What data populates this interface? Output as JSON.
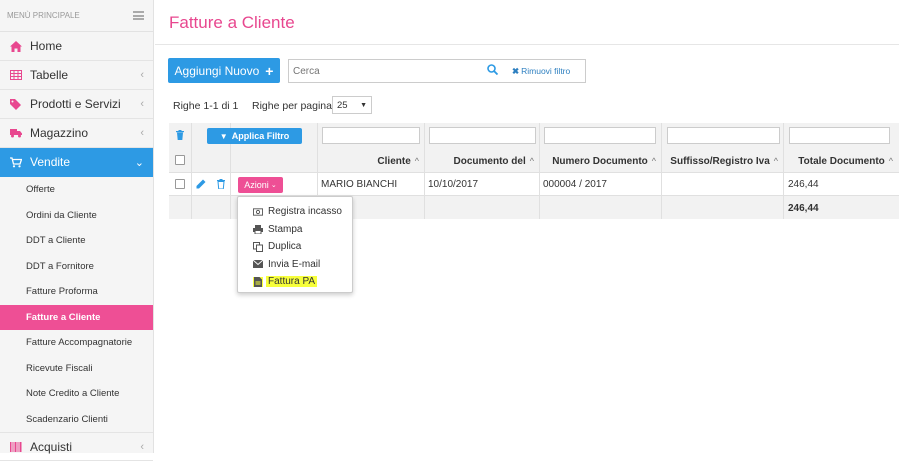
{
  "sidebar": {
    "header": "MENÙ PRINCIPALE",
    "items": [
      {
        "label": "Home",
        "icon": "home-icon"
      },
      {
        "label": "Tabelle",
        "icon": "table-icon"
      },
      {
        "label": "Prodotti e Servizi",
        "icon": "tags-icon"
      },
      {
        "label": "Magazzino",
        "icon": "truck-icon"
      },
      {
        "label": "Vendite",
        "icon": "cart-icon"
      }
    ],
    "subitems": [
      "Offerte",
      "Ordini da Cliente",
      "DDT a Cliente",
      "DDT a Fornitore",
      "Fatture Proforma",
      "Fatture a Cliente",
      "Fatture Accompagnatorie",
      "Ricevute Fiscali",
      "Note Credito a Cliente",
      "Scadenzario Clienti"
    ],
    "last_item": {
      "label": "Acquisti",
      "icon": "barcode-icon"
    }
  },
  "page": {
    "title": "Fatture a Cliente",
    "add_button": "Aggiungi Nuovo",
    "search_placeholder": "Cerca",
    "remove_filter": "Rimuovi filtro",
    "rows_info": "Righe 1-1 di 1",
    "rows_per_page_label": "Righe per pagina",
    "rows_per_page_value": "25"
  },
  "table": {
    "apply_filter": "Applica Filtro",
    "columns": [
      "Cliente",
      "Documento del",
      "Numero Documento",
      "Suffisso/Registro Iva",
      "Totale Documento"
    ],
    "row": {
      "actions_label": "Azioni",
      "cliente": "MARIO BIANCHI",
      "documento_del": "10/10/2017",
      "numero_documento": "000004 / 2017",
      "suffisso": "",
      "totale": "246,44"
    },
    "footer_total": "246,44"
  },
  "dropdown": {
    "items": [
      {
        "label": "Registra incasso",
        "icon": "money-icon"
      },
      {
        "label": "Stampa",
        "icon": "print-icon"
      },
      {
        "label": "Duplica",
        "icon": "copy-icon"
      },
      {
        "label": "Invia E-mail",
        "icon": "envelope-icon"
      },
      {
        "label": "Fattura PA",
        "icon": "file-icon"
      }
    ]
  },
  "colors": {
    "accent_pink": "#ee4f95",
    "accent_blue": "#2d9ae4",
    "highlight": "#f7ff3b"
  }
}
